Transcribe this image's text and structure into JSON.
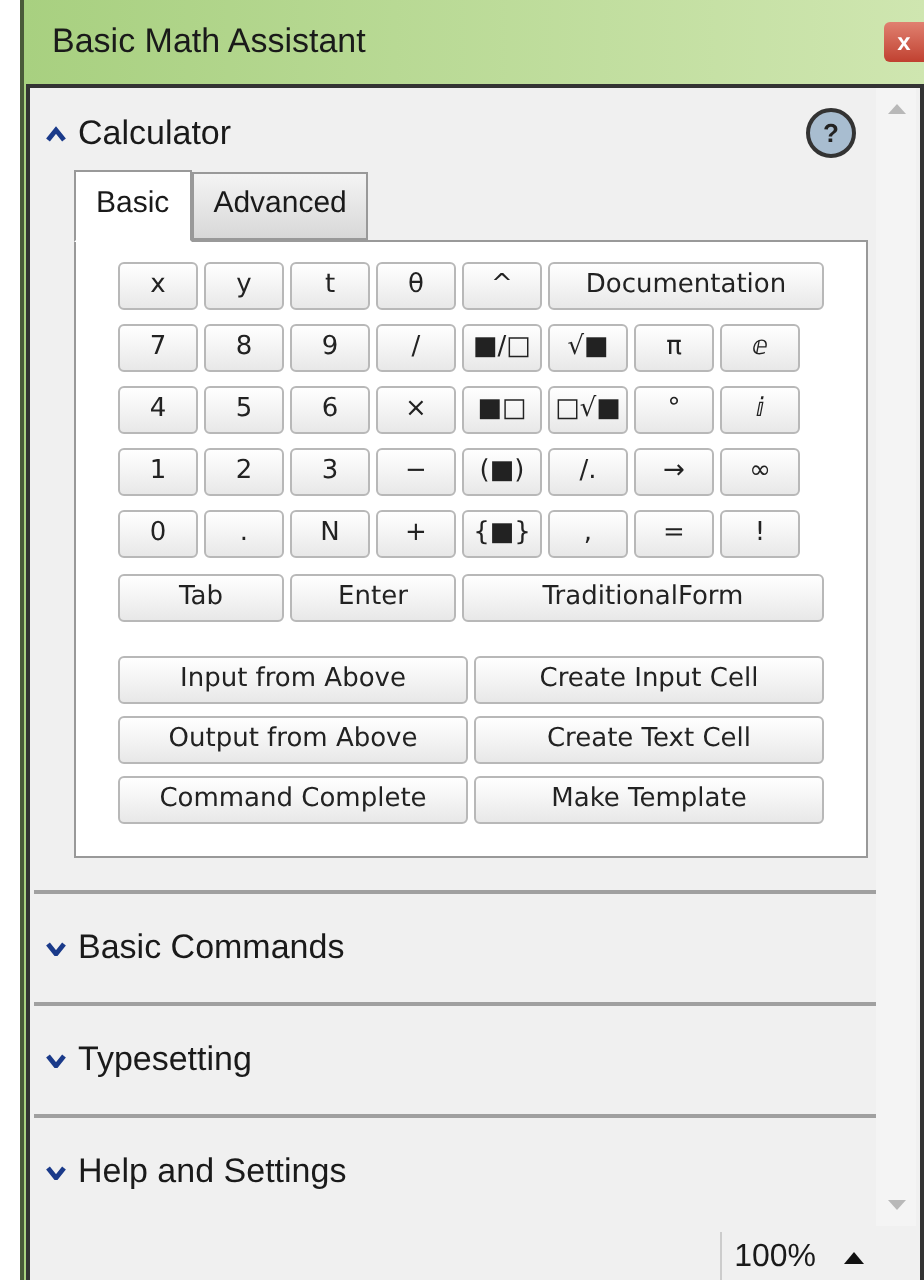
{
  "window": {
    "title": "Basic Math Assistant",
    "close": "x"
  },
  "sections": [
    {
      "title": "Calculator",
      "expanded": true,
      "help": "?",
      "tabs": [
        {
          "label": "Basic",
          "selected": true
        },
        {
          "label": "Advanced",
          "selected": false
        }
      ],
      "key_rows": [
        [
          "x",
          "y",
          "t",
          "θ",
          "^",
          "Documentation"
        ],
        [
          "7",
          "8",
          "9",
          "/",
          "■/□",
          "√■",
          "π",
          "ⅇ"
        ],
        [
          "4",
          "5",
          "6",
          "×",
          "■□",
          "□√■",
          "°",
          "ⅈ"
        ],
        [
          "1",
          "2",
          "3",
          "−",
          "(■)",
          "/.",
          "→",
          "∞"
        ],
        [
          "0",
          ".",
          "N",
          "+",
          "{■}",
          ",",
          "=",
          "!"
        ],
        [
          "Tab",
          "Enter",
          "TraditionalForm"
        ]
      ],
      "action_rows": [
        [
          "Input from Above",
          "Create Input Cell"
        ],
        [
          "Output from Above",
          "Create Text Cell"
        ],
        [
          "Command Complete",
          "Make Template"
        ]
      ]
    },
    {
      "title": "Basic Commands",
      "expanded": false
    },
    {
      "title": "Typesetting",
      "expanded": false
    },
    {
      "title": "Help and Settings",
      "expanded": false
    }
  ],
  "status_bar": {
    "zoom": "100%"
  }
}
